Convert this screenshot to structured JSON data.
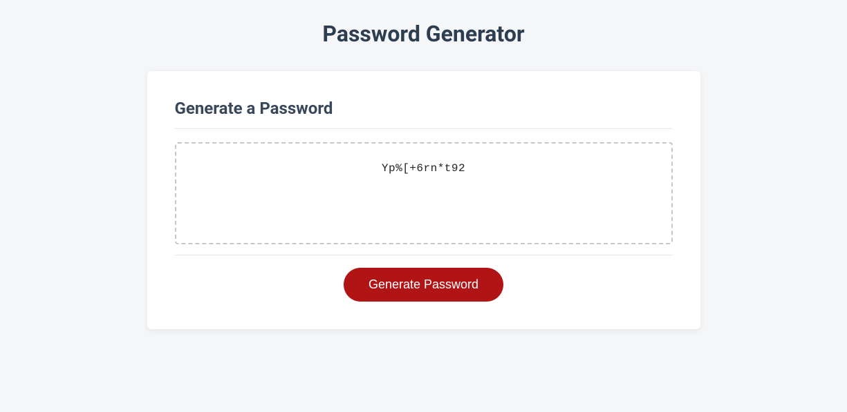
{
  "page": {
    "title": "Password Generator"
  },
  "card": {
    "section_title": "Generate a Password",
    "password_value": "Yp%[+6rn*t92",
    "button_label": "Generate Password"
  }
}
